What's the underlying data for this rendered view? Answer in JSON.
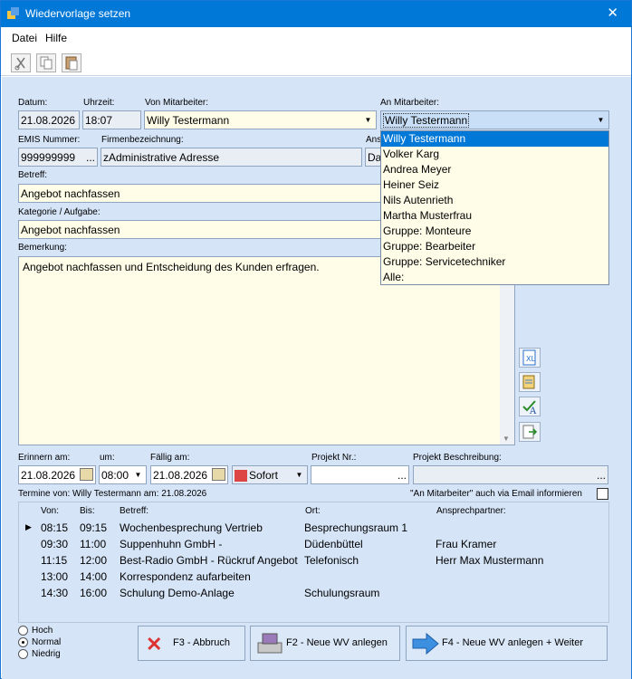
{
  "window": {
    "title": "Wiedervorlage setzen",
    "close": "✕"
  },
  "menu": {
    "datei": "Datei",
    "hilfe": "Hilfe"
  },
  "labels": {
    "datum": "Datum:",
    "uhrzeit": "Uhrzeit:",
    "von": "Von Mitarbeiter:",
    "an": "An Mitarbeiter:",
    "emis": "EMIS Nummer:",
    "firma": "Firmenbezeichnung:",
    "ans": "Ans",
    "betreff": "Betreff:",
    "kategorie": "Kategorie / Aufgabe:",
    "bemerkung": "Bemerkung:",
    "erinnern": "Erinnern am:",
    "um": "um:",
    "faellig": "Fällig am:",
    "projekt_nr": "Projekt Nr.:",
    "projekt_beschr": "Projekt Beschreibung:",
    "termine": "Termine von: Willy Testermann am: 21.08.2026",
    "email_info": "\"An Mitarbeiter\" auch via Email informieren"
  },
  "fields": {
    "datum": "21.08.2026",
    "uhrzeit": "18:07",
    "von": "Willy Testermann",
    "an": "Willy Testermann",
    "emis": "999999999",
    "emis_btn": "...",
    "firma": "zAdministrative Adresse",
    "ans": "Da",
    "betreff": "Angebot nachfassen",
    "kategorie": "Angebot nachfassen",
    "bemerkung": "Angebot nachfassen und Entscheidung des Kunden erfragen.",
    "erinnern": "21.08.2026",
    "um": "08:00",
    "faellig": "21.08.2026",
    "sofort": "Sofort",
    "projekt_nr": "",
    "projekt_btn": "...",
    "projekt_beschr": "",
    "projekt_beschr_btn": "..."
  },
  "dropdown": [
    "Willy Testermann",
    "Volker Karg",
    "Andrea Meyer",
    "Heiner Seiz",
    "Nils Autenrieth",
    "Martha Musterfrau",
    "Gruppe: Monteure",
    "Gruppe: Bearbeiter",
    "Gruppe: Servicetechniker",
    "Alle:"
  ],
  "grid": {
    "headers": [
      "Von:",
      "Bis:",
      "Betreff:",
      "Ort:",
      "Ansprechpartner:"
    ],
    "rows": [
      [
        "08:15",
        "09:15",
        "Wochenbesprechung Vertrieb",
        "Besprechungsraum 1",
        ""
      ],
      [
        "09:30",
        "11:00",
        "Suppenhuhn GmbH -",
        "Düdenbüttel",
        "Frau Kramer"
      ],
      [
        "11:15",
        "12:00",
        "Best-Radio GmbH - Rückruf Angebot",
        "Telefonisch",
        "Herr Max Mustermann"
      ],
      [
        "13:00",
        "14:00",
        "Korrespondenz aufarbeiten",
        "",
        ""
      ],
      [
        "14:30",
        "16:00",
        "Schulung Demo-Anlage",
        "Schulungsraum",
        ""
      ]
    ]
  },
  "priority": {
    "hoch": "Hoch",
    "normal": "Normal",
    "niedrig": "Niedrig",
    "selected": "Normal"
  },
  "buttons": {
    "abbruch": "F3 - Abbruch",
    "neu": "F2 - Neue WV anlegen",
    "weiter": "F4 - Neue WV anlegen + Weiter"
  },
  "colors": {
    "titlebar": "#0078d7",
    "form_bg": "#d5e4f7",
    "field_yellow": "#fffde8",
    "selection": "#0078d7"
  }
}
